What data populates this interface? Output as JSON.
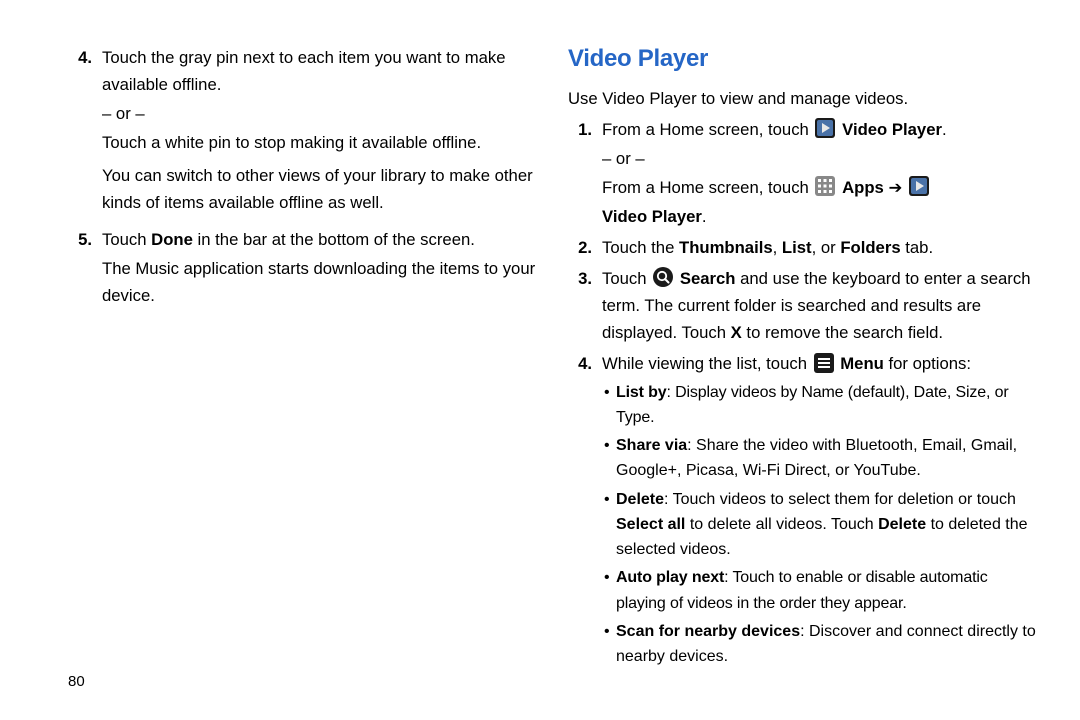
{
  "left": {
    "item4": {
      "num": "4.",
      "p1": "Touch the gray pin next to each item you want to make available offline.",
      "or": "– or –",
      "p2": "Touch a white pin to stop making it available offline.",
      "p3": "You can switch to other views of your library to make other kinds of items available offline as well."
    },
    "item5": {
      "num": "5.",
      "p1a": "Touch ",
      "p1b": "Done",
      "p1c": " in the bar at the bottom of the screen.",
      "p2": "The Music application starts downloading the items to your device."
    }
  },
  "right": {
    "heading": "Video Player",
    "intro": "Use Video Player to view and manage videos.",
    "item1": {
      "num": "1.",
      "line1a": "From a Home screen, touch ",
      "line1b": "Video Player",
      "line1c": ".",
      "or": "– or –",
      "line2a": "From a Home screen, touch ",
      "apps": "Apps",
      "arrow": " ➔ ",
      "vp": "Video Player",
      "dot": "."
    },
    "item2": {
      "num": "2.",
      "a": "Touch the ",
      "thumbs": "Thumbnails",
      "c": ", ",
      "list": "List",
      "c2": ", or ",
      "folders": "Folders",
      "tail": " tab."
    },
    "item3": {
      "num": "3.",
      "a": "Touch ",
      "search": "Search",
      "rest": " and use the keyboard to enter a search term. The current folder is searched and results are displayed. Touch ",
      "x": "X",
      "rest2": " to remove the search field."
    },
    "item4": {
      "num": "4.",
      "a": "While viewing the list, touch ",
      "menu": "Menu",
      "rest": " for options:"
    },
    "bullets": {
      "b1a": "List by",
      "b1b": ": Display videos by Name (default), Date, Size, or Type.",
      "b2a": "Share via",
      "b2b": ": Share the video with Bluetooth, Email, Gmail, Google+, Picasa, Wi-Fi Direct, or YouTube.",
      "b3a": "Delete",
      "b3b": ": Touch videos to select them for deletion or touch ",
      "b3c": "Select all",
      "b3d": " to delete all videos. Touch ",
      "b3e": "Delete",
      "b3f": " to deleted the selected videos.",
      "b4a": "Auto play next",
      "b4b": ": Touch to enable or disable automatic playing of videos in the order they appear.",
      "b5a": "Scan for nearby devices",
      "b5b": ": Discover and connect directly to nearby devices."
    }
  },
  "page_number": "80"
}
